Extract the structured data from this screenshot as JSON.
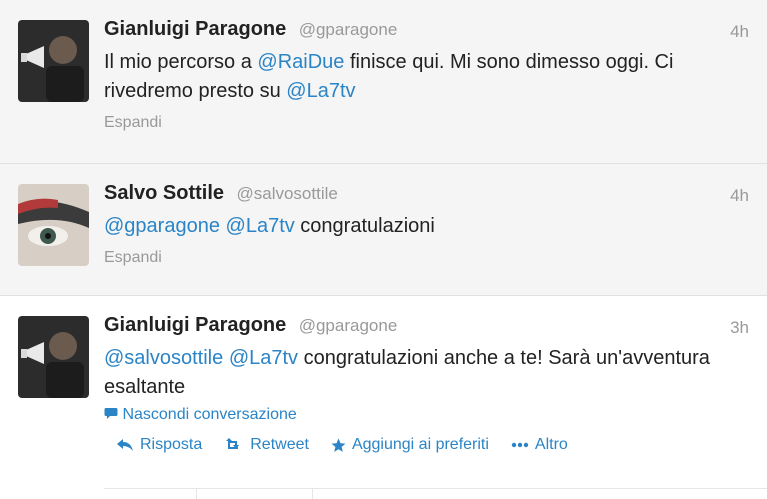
{
  "tweets": [
    {
      "fullname": "Gianluigi Paragone",
      "username": "@gparagone",
      "time": "4h",
      "text": [
        {
          "t": "Il mio percorso a ",
          "m": false
        },
        {
          "t": "@RaiDue",
          "m": true
        },
        {
          "t": " finisce qui. Mi sono dimesso oggi. Ci rivedremo presto su ",
          "m": false
        },
        {
          "t": "@La7tv",
          "m": true
        }
      ],
      "expand": "Espandi"
    },
    {
      "fullname": "Salvo Sottile",
      "username": "@salvosottile",
      "time": "4h",
      "text": [
        {
          "t": "@gparagone",
          "m": true
        },
        {
          "t": " ",
          "m": false
        },
        {
          "t": "@La7tv",
          "m": true
        },
        {
          "t": " congratulazioni",
          "m": false
        }
      ],
      "expand": "Espandi"
    },
    {
      "fullname": "Gianluigi Paragone",
      "username": "@gparagone",
      "time": "3h",
      "text": [
        {
          "t": "@salvosottile",
          "m": true
        },
        {
          "t": " ",
          "m": false
        },
        {
          "t": "@La7tv",
          "m": true
        },
        {
          "t": " congratulazioni anche a te! Sarà un'avventura esaltante",
          "m": false
        }
      ],
      "conversation": "Nascondi conversazione",
      "actions": {
        "reply": "Risposta",
        "retweet": "Retweet",
        "favorite": "Aggiungi ai preferiti",
        "more": "Altro"
      }
    }
  ],
  "colors": {
    "link": "#2a84c6",
    "muted": "#999999"
  },
  "icons": {
    "conversation": "speech-bubble-icon",
    "reply": "reply-arrow-icon",
    "retweet": "retweet-icon",
    "favorite": "star-icon",
    "more": "ellipsis-icon"
  }
}
